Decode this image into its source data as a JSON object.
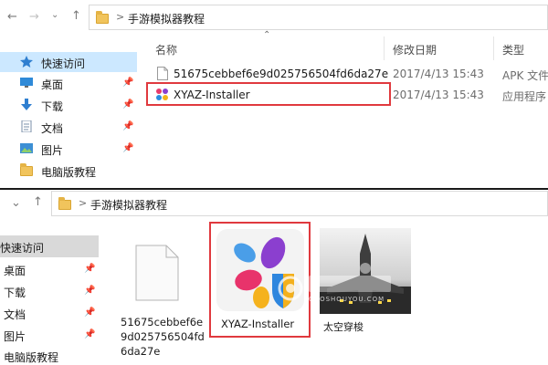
{
  "top": {
    "breadcrumb_sep": ">",
    "path": "手游模拟器教程",
    "columns": {
      "name": "名称",
      "date": "修改日期",
      "type": "类型"
    },
    "sidebar": [
      {
        "label": "快速访问",
        "icon": "star-icon"
      },
      {
        "label": "桌面",
        "icon": "desktop-icon"
      },
      {
        "label": "下载",
        "icon": "download-icon"
      },
      {
        "label": "文档",
        "icon": "document-icon"
      },
      {
        "label": "图片",
        "icon": "pictures-icon"
      },
      {
        "label": "电脑版教程",
        "icon": "folder-icon"
      }
    ],
    "files": [
      {
        "name": "51675cebbef6e9d025756504fd6da27e",
        "date": "2017/4/13 15:43",
        "type": "APK 文件",
        "icon": "blank-file-icon"
      },
      {
        "name": "XYAZ-Installer",
        "date": "2017/4/13 15:43",
        "type": "应用程序",
        "icon": "xyaz-app-icon"
      }
    ],
    "highlight_color": "#e0393e"
  },
  "bottom": {
    "breadcrumb_sep": ">",
    "path": "手游模拟器教程",
    "sidebar": [
      {
        "label": "快速访问"
      },
      {
        "label": "桌面"
      },
      {
        "label": "下载"
      },
      {
        "label": "文档"
      },
      {
        "label": "图片"
      },
      {
        "label": "电脑版教程"
      }
    ],
    "tiles": [
      {
        "line1": "51675cebbef6e",
        "line2": "9d025756504fd",
        "line3": "6da27e",
        "icon": "blank-file-icon"
      },
      {
        "line1": "XYAZ-Installer",
        "icon": "xyaz-app-icon"
      },
      {
        "line1": "太空穿梭",
        "icon": "space-shuttle-thumbnail"
      }
    ],
    "watermark": "GAOSHOUYOU.COM"
  }
}
